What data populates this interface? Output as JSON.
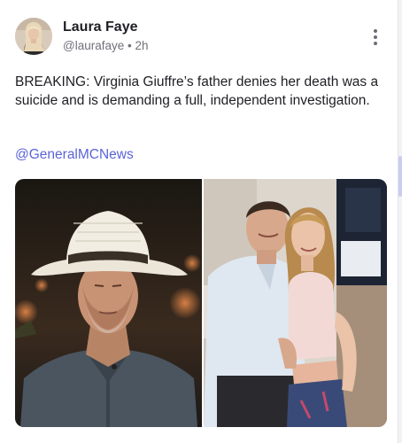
{
  "post": {
    "author_name": "Laura Faye",
    "author_meta": "@laurafaye • 2h",
    "text": "BREAKING: Virginia Giuffre’s father denies her death was a suicide and is demanding a full, independent investigation.",
    "mention": "@GeneralMCNews"
  },
  "icons": {
    "more": "more-vertical-icon"
  },
  "colors": {
    "mention": "#5a64d8",
    "text": "#1e1e24",
    "meta": "#70707a"
  }
}
